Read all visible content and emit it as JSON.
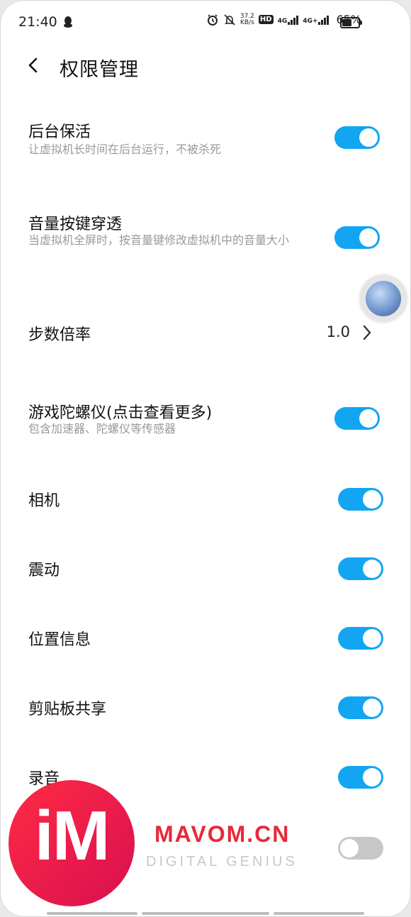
{
  "status_bar": {
    "time": "21:40",
    "net_speed_top": "37.2",
    "net_speed_unit": "KB/s",
    "hd": "HD",
    "sim1": "4G",
    "sim2": "4G+",
    "battery_pct": "65%",
    "battery_level": 0.65
  },
  "header": {
    "title": "权限管理"
  },
  "items": [
    {
      "title": "后台保活",
      "desc": "让虚拟机长时间在后台运行，不被杀死",
      "on": true
    },
    {
      "title": "音量按键穿透",
      "desc": "当虚拟机全屏时，按音量键修改虚拟机中的音量大小",
      "on": true
    },
    {
      "title": "步数倍率",
      "value": "1.0"
    },
    {
      "title": "游戏陀螺仪(点击查看更多)",
      "desc": "包含加速器、陀螺仪等传感器",
      "on": true
    },
    {
      "title": "相机",
      "on": true
    },
    {
      "title": "震动",
      "on": true
    },
    {
      "title": "位置信息",
      "on": true
    },
    {
      "title": "剪贴板共享",
      "on": true
    },
    {
      "title": "录音",
      "on": true
    },
    {
      "title": "",
      "on": false
    }
  ],
  "watermark": {
    "logo": "iM",
    "brand": "MAVOM.CN",
    "tagline": "DIGITAL GENIUS"
  },
  "colors": {
    "accent": "#12a5f2",
    "off": "#c7c7c7",
    "brand": "#e8283a"
  }
}
